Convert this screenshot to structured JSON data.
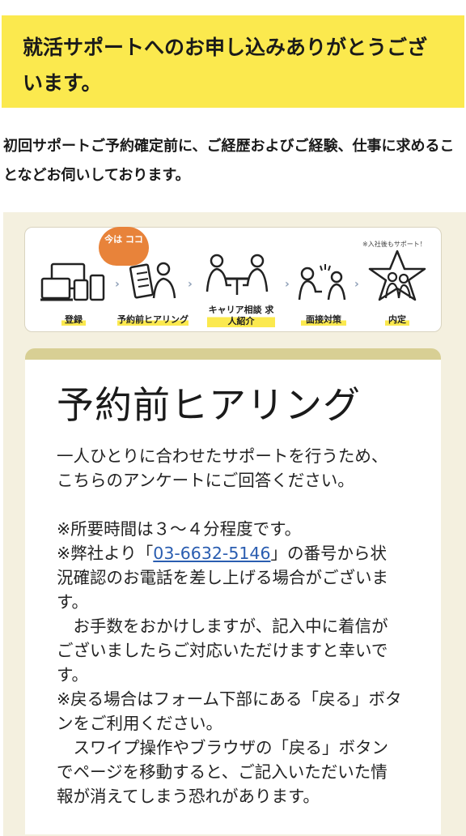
{
  "banner": {
    "title": "就活サポートへのお申し込みありがとうございます。"
  },
  "lead": "初回サポートご予約確定前に、ご経歴およびご経験、仕事に求めることなどお伺いしております。",
  "steps": {
    "badge": "今は ココ",
    "after_note": "※入社後もサポート！",
    "items": [
      {
        "label": "登録"
      },
      {
        "label": "予約前ヒアリング"
      },
      {
        "label": "キャリア相談 求人紹介"
      },
      {
        "label": "面接対策"
      },
      {
        "label": "内定"
      }
    ]
  },
  "card": {
    "title": "予約前ヒアリング",
    "intro": "一人ひとりに合わせたサポートを行うため、こちらのアンケートにご回答ください。",
    "note_time": "※所要時間は３～４分程度です。",
    "note_call_prefix": "※弊社より「",
    "phone": "03-6632-5146",
    "note_call_suffix": "」の番号から状況確認のお電話を差し上げる場合がございます。",
    "note_apology": "　お手数をおかけしますが、記入中に着信がございましたらご対応いただけますと幸いです。",
    "note_back": "※戻る場合はフォーム下部にある「戻る」ボタンをご利用ください。",
    "note_swipe": "　スワイプ操作やブラウザの「戻る」ボタンでページを移動すると、ご記入いただいた情報が消えてしまう恐れがあります。"
  }
}
